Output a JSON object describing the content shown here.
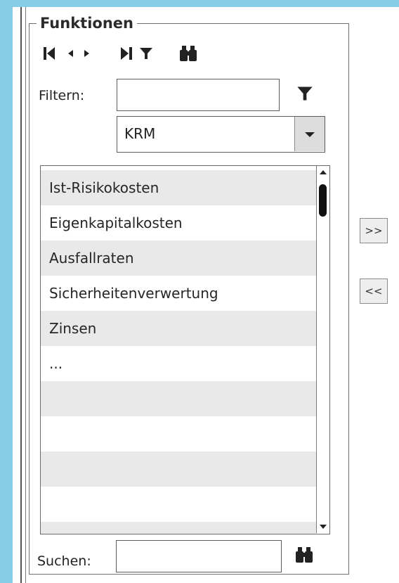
{
  "panel": {
    "legend": "Funktionen",
    "toolbar_icons": [
      "first-record-icon",
      "previous-icon",
      "next-icon",
      "last-record-icon",
      "filter-icon",
      "binoculars-icon"
    ]
  },
  "filter": {
    "label": "Filtern:",
    "value": "",
    "icon": "filter-icon"
  },
  "dropdown": {
    "selected": "KRM"
  },
  "list": {
    "items": [
      "Ist-Risikokosten",
      "Eigenkapitalkosten",
      "Ausfallraten",
      "Sicherheitenverwertung",
      "Zinsen",
      "..."
    ],
    "empty_rows": 5
  },
  "transfer": {
    "add_label": ">>",
    "remove_label": "<<"
  },
  "search": {
    "label": "Suchen:",
    "value": "",
    "icon": "binoculars-icon"
  },
  "colors": {
    "accent_edge": "#87cde8",
    "alt_row": "#e9e9e9"
  }
}
